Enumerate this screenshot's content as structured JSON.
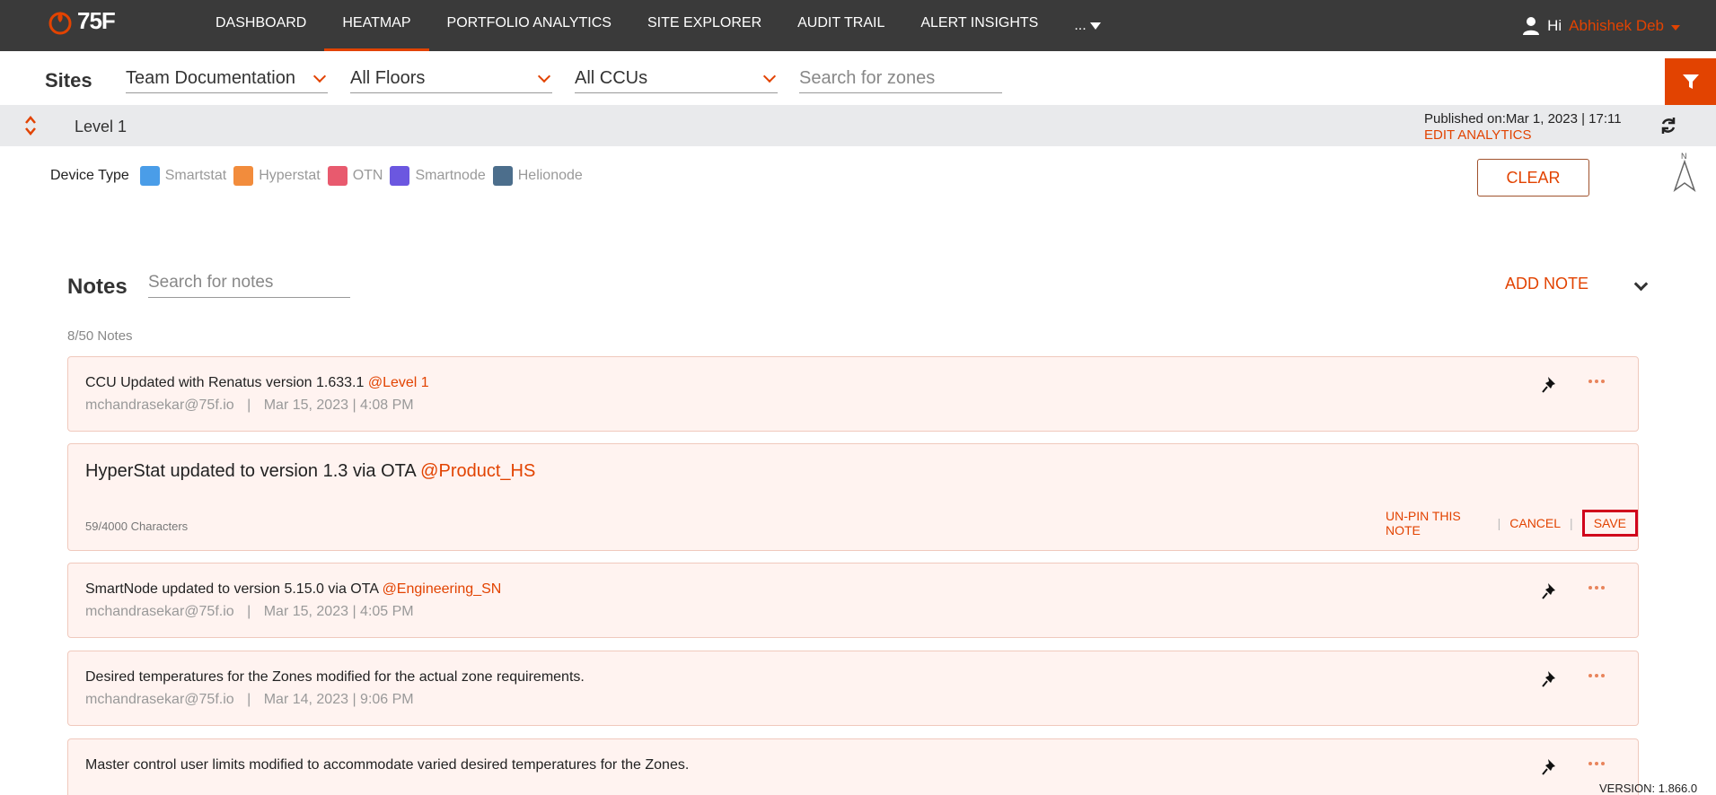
{
  "brand": {
    "logo_text": "75F",
    "accent": "#e24301"
  },
  "nav": {
    "items": [
      {
        "label": "DASHBOARD",
        "active": false
      },
      {
        "label": "HEATMAP",
        "active": true
      },
      {
        "label": "PORTFOLIO ANALYTICS",
        "active": false
      },
      {
        "label": "SITE EXPLORER",
        "active": false
      },
      {
        "label": "AUDIT TRAIL",
        "active": false
      },
      {
        "label": "ALERT INSIGHTS",
        "active": false
      }
    ],
    "more_label": "...",
    "greeting": "Hi",
    "user_name": "Abhishek Deb"
  },
  "filters": {
    "sites_label": "Sites",
    "site": "Team Documentation",
    "floor": "All Floors",
    "ccu": "All CCUs",
    "zone_search_placeholder": "Search for zones"
  },
  "level": {
    "name": "Level 1",
    "published": "Published on:Mar 1, 2023 | 17:11",
    "edit_analytics": "EDIT ANALYTICS"
  },
  "device_types": {
    "label": "Device Type",
    "items": [
      {
        "name": "Smartstat",
        "color": "#4a9de8"
      },
      {
        "name": "Hyperstat",
        "color": "#f28c3c"
      },
      {
        "name": "OTN",
        "color": "#e85a6e"
      },
      {
        "name": "Smartnode",
        "color": "#6b57e0"
      },
      {
        "name": "Helionode",
        "color": "#4c6e8c"
      }
    ],
    "clear_label": "CLEAR",
    "north_label": "N"
  },
  "notes": {
    "title": "Notes",
    "search_placeholder": "Search for notes",
    "add_label": "ADD NOTE",
    "count": "8/50 Notes",
    "list": [
      {
        "text": "CCU Updated with Renatus version 1.633.1",
        "mention": "@Level 1",
        "author": "mchandrasekar@75f.io",
        "date": "Mar 15, 2023 | 4:08 PM"
      },
      {
        "text": "SmartNode updated to version 5.15.0  via OTA",
        "mention": "@Engineering_SN",
        "author": "mchandrasekar@75f.io",
        "date": "Mar 15, 2023 | 4:05 PM"
      },
      {
        "text": "Desired temperatures for the Zones modified for the actual zone requirements.",
        "mention": "",
        "author": "mchandrasekar@75f.io",
        "date": "Mar 14, 2023 | 9:06 PM"
      },
      {
        "text": "Master control user limits modified to accommodate varied desired temperatures for the Zones.",
        "mention": "",
        "author": "",
        "date": ""
      }
    ],
    "editing": {
      "text": "HyperStat updated to version 1.3 via OTA",
      "mention": "@Product_HS",
      "char_count": "59/4000 Characters",
      "unpin_label": "UN-PIN THIS NOTE",
      "cancel_label": "CANCEL",
      "save_label": "SAVE"
    },
    "meta_sep": "|"
  },
  "version": "VERSION: 1.866.0"
}
